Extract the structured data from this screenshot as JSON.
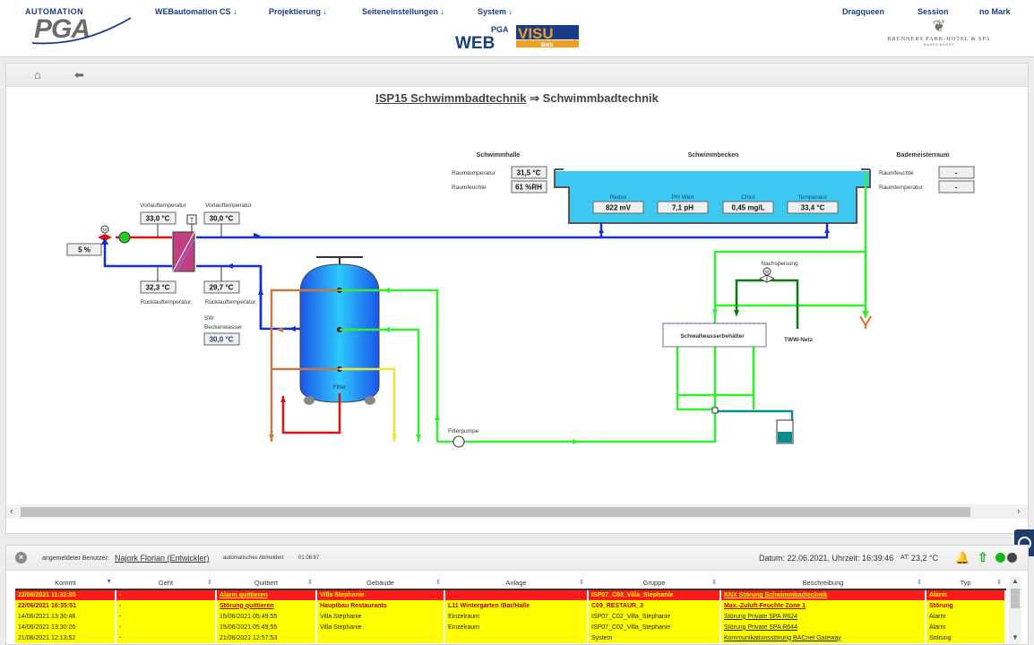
{
  "header": {
    "logo_top": "AUTOMATION",
    "logo_main": "PGA",
    "menu": [
      "WEBautomation CS ↓",
      "Projektierung ↓",
      "Seiteneinstellungen ↓",
      "System ↓"
    ],
    "right_menu": [
      "Dragqueen",
      "Session",
      "no Mark"
    ],
    "webvisu_small": "PGA",
    "webvisu_web": "WEB",
    "webvisu_visu": "VISU",
    "webvisu_bms": "BMS",
    "hotel_name": "BRENNERS PARK-HOTEL & SPA",
    "hotel_sub": "BADEN-BADEN"
  },
  "title": {
    "link": "ISP15 Schwimmbadtechnik",
    "arrow": "⇒",
    "current": "Schwimmbadtechnik"
  },
  "schema": {
    "schwimmhalle": {
      "label": "Schwimmhalle",
      "raumtemp_label": "Raumtemperatur",
      "raumtemp": "31,5 °C",
      "raumfeuchte_label": "Raumfeuchte",
      "raumfeuchte": "61 %RH"
    },
    "becken": {
      "label": "Schwimmbecken",
      "redox_label": "Redox",
      "redox": "822 mV",
      "ph_label": "PH Wert",
      "ph": "7,1 pH",
      "chlor_label": "Chlor",
      "chlor": "0,45 mg/L",
      "temp_label": "Temperatur",
      "temp": "33,4 °C"
    },
    "bademeister": {
      "label": "Bademeisterraum",
      "feuchte_label": "Raumfeuchte",
      "feuchte": "-",
      "temp_label": "Raumtemperatur",
      "temp": "-"
    },
    "heizung": {
      "vorlauf1_label": "Vorlauftemperatur",
      "vorlauf1": "33,0 °C",
      "vorlauf2_label": "Vorlauftemperatur",
      "vorlauf2": "30,0 °C",
      "ruecklauf1_label": "Rücklauftemperatur",
      "ruecklauf1": "32,3 °C",
      "ruecklauf2_label": "Rücklauftemperatur",
      "ruecklauf2": "29,7 °C",
      "ventil": "5 %",
      "sw_label1": "SW",
      "sw_label2": "Beckenwasser",
      "sw": "30,0 °C"
    },
    "filter_label": "Filter",
    "filterpumpe_label": "Filterpumpe",
    "nachspeisung_label": "Nachspeisung",
    "schwallwasser_label": "Schwallwasserbehälter",
    "tww_label": "TWW-Netz"
  },
  "info_bar": {
    "user_label": "angemeldeter Benutzer:",
    "user": "Najork Florian (Entwickler)",
    "logout_label": "automatisches Abmelden:",
    "logout": "01:08:67",
    "datum": "Datum: 22.06.2021, Uhrzeit: 16:39:46",
    "at_label": "AT:",
    "at": "23,2 °C"
  },
  "alarm_table": {
    "headers": [
      "Kommt",
      "Geht",
      "Quittiert",
      "Gebäude",
      "Anlage",
      "Gruppe",
      "Beschreibung",
      "Typ"
    ],
    "rows": [
      {
        "style": "red",
        "cells": [
          "22/06/2021 11:32:55",
          "-",
          "Alarm quittieren",
          "Villa Stephanie",
          "",
          "ISP07_C03_Villa_Stephanie",
          "KNX Störung Schwimmbadtechnik",
          "Alarm"
        ]
      },
      {
        "style": "ylw b",
        "cells": [
          "22/06/2021 16:35:51",
          "-",
          "Störung quittieren",
          "Hauptbau Restaurants",
          "L11 Wintergarten /Bar/Halle",
          "C09_RESTAUR_3",
          "Max.-Zuluft-Feuchte Zone 1",
          "Störung"
        ]
      },
      {
        "style": "ylw",
        "cells": [
          "14/06/2021 13:30:46",
          "-",
          "15/06/2021 05:49:55",
          "Villa Stephanie",
          "Einzelraum",
          "ISP07_C02_Villa_Stephanie",
          "Störung Private SPA R624",
          "Alarm"
        ]
      },
      {
        "style": "ylw",
        "cells": [
          "14/06/2021 13:30:26",
          "-",
          "15/06/2021 05:49:55",
          "Villa Stephanie",
          "Einzelraum",
          "ISP07_C02_Villa_Stephanie",
          "Störung Private SPA R644",
          "Alarm"
        ]
      },
      {
        "style": "ylw",
        "cells": [
          "21/06/2021 12:13:52",
          "-",
          "21/06/2021 12:57:53",
          "",
          "",
          "System",
          "Kommunikationsstörung BACnet Gateway",
          "Störung"
        ]
      }
    ]
  },
  "colors": {
    "menu_blue": "#1a3c87",
    "water": "#3cc8f0",
    "pipe_blue": "#1530c8",
    "pipe_red": "#e01010",
    "pipe_green": "#33ee33",
    "pipe_orange": "#c87840",
    "pipe_yellow": "#e8e830"
  }
}
